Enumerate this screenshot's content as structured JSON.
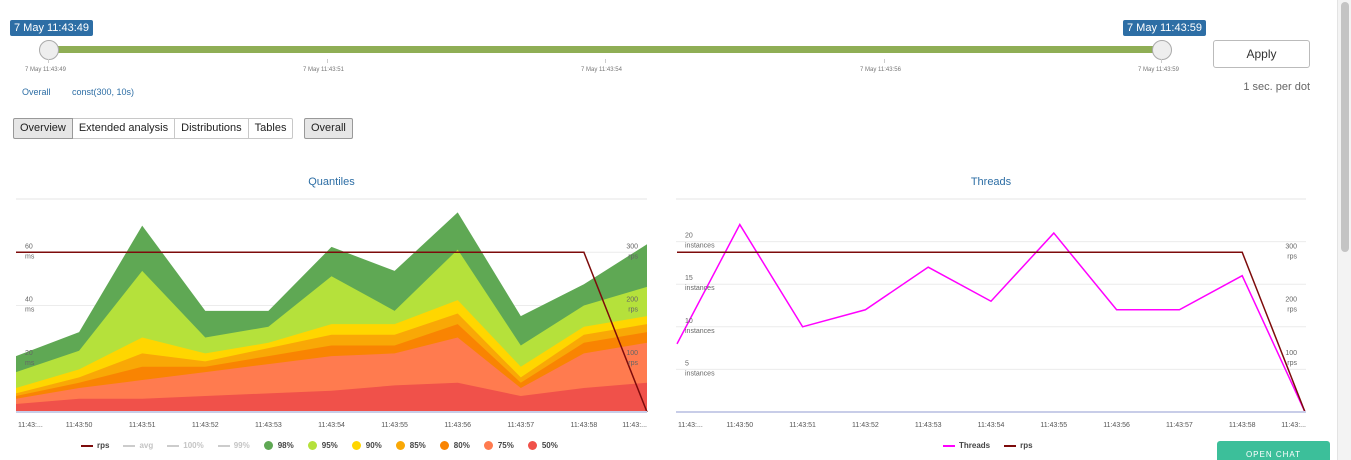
{
  "range": {
    "start_label": "7 May 11:43:49",
    "end_label": "7 May 11:43:59",
    "ticks": [
      "7 May 11:43:49",
      "7 May 11:43:51",
      "7 May 11:43:54",
      "7 May 11:43:56",
      "7 May 11:43:59"
    ],
    "track_color": "#8fae55"
  },
  "apply_label": "Apply",
  "per_dot_label": "1 sec. per dot",
  "links": {
    "overall": "Overall",
    "const": "const(300, 10s)"
  },
  "tabs": [
    {
      "label": "Overview",
      "active": true
    },
    {
      "label": "Extended analysis",
      "active": false
    },
    {
      "label": "Distributions",
      "active": false
    },
    {
      "label": "Tables",
      "active": false
    }
  ],
  "overall_button": "Overall",
  "chat_button": "OPEN CHAT",
  "chart_data": [
    {
      "type": "area",
      "title": "Quantiles",
      "x": [
        "11:43:...",
        "11:43:50",
        "11:43:51",
        "11:43:52",
        "11:43:53",
        "11:43:54",
        "11:43:55",
        "11:43:56",
        "11:43:57",
        "11:43:58",
        "11:43:..."
      ],
      "y_left": {
        "ticks": [
          20,
          40,
          60
        ],
        "unit": "ms",
        "ylim": [
          0,
          80
        ]
      },
      "y_right": {
        "ticks": [
          100,
          200,
          300
        ],
        "unit": "rps",
        "ylim": [
          0,
          400
        ]
      },
      "series": [
        {
          "name": "98%",
          "color": "#5fa854",
          "values": [
            21,
            30,
            70,
            38,
            38,
            62,
            53,
            75,
            36,
            48,
            63
          ]
        },
        {
          "name": "95%",
          "color": "#b5e13b",
          "values": [
            15,
            23,
            53,
            28,
            32,
            51,
            38,
            61,
            25,
            40,
            47
          ]
        },
        {
          "name": "90%",
          "color": "#ffd600",
          "values": [
            9,
            16,
            28,
            22,
            26,
            33,
            33,
            42,
            17,
            32,
            36
          ]
        },
        {
          "name": "85%",
          "color": "#f9a806",
          "values": [
            7,
            13,
            22,
            19,
            24,
            29,
            29,
            37,
            13,
            29,
            33
          ]
        },
        {
          "name": "80%",
          "color": "#f98402",
          "values": [
            6,
            11,
            17,
            17,
            21,
            25,
            25,
            33,
            11,
            26,
            30
          ]
        },
        {
          "name": "75%",
          "color": "#ff7b4f",
          "values": [
            5,
            9,
            12,
            15,
            18,
            21,
            22,
            28,
            9,
            22,
            26
          ]
        },
        {
          "name": "50%",
          "color": "#f0514a",
          "values": [
            3,
            5,
            5,
            6,
            7,
            8,
            10,
            11,
            6,
            9,
            11
          ]
        }
      ],
      "rps": {
        "name": "rps",
        "color": "#7d0b0b",
        "values": [
          300,
          300,
          300,
          300,
          300,
          300,
          300,
          300,
          300,
          300,
          0
        ]
      },
      "legend": [
        {
          "name": "rps",
          "kind": "line",
          "color": "#7d0b0b",
          "enabled": true
        },
        {
          "name": "avg",
          "kind": "line",
          "color": "#cccccc",
          "enabled": false
        },
        {
          "name": "100%",
          "kind": "line",
          "color": "#cccccc",
          "enabled": false
        },
        {
          "name": "99%",
          "kind": "line",
          "color": "#cccccc",
          "enabled": false
        },
        {
          "name": "98%",
          "kind": "dot",
          "color": "#5fa854",
          "enabled": true
        },
        {
          "name": "95%",
          "kind": "dot",
          "color": "#b5e13b",
          "enabled": true
        },
        {
          "name": "90%",
          "kind": "dot",
          "color": "#ffd600",
          "enabled": true
        },
        {
          "name": "85%",
          "kind": "dot",
          "color": "#f9a806",
          "enabled": true
        },
        {
          "name": "80%",
          "kind": "dot",
          "color": "#f98402",
          "enabled": true
        },
        {
          "name": "75%",
          "kind": "dot",
          "color": "#ff7b4f",
          "enabled": true
        },
        {
          "name": "50%",
          "kind": "dot",
          "color": "#f0514a",
          "enabled": true
        }
      ]
    },
    {
      "type": "line",
      "title": "Threads",
      "x": [
        "11:43:...",
        "11:43:50",
        "11:43:51",
        "11:43:52",
        "11:43:53",
        "11:43:54",
        "11:43:55",
        "11:43:56",
        "11:43:57",
        "11:43:58",
        "11:43:..."
      ],
      "y_left": {
        "ticks": [
          5,
          10,
          15,
          20
        ],
        "unit": "instances",
        "ylim": [
          0,
          25
        ]
      },
      "y_right": {
        "ticks": [
          100,
          200,
          300
        ],
        "unit": "rps",
        "ylim": [
          0,
          400
        ]
      },
      "series": [
        {
          "name": "Threads",
          "color": "#ff00ff",
          "values": [
            8,
            22,
            10,
            12,
            17,
            13,
            21,
            12,
            12,
            16,
            0
          ]
        },
        {
          "name": "rps",
          "color": "#7d0b0b",
          "values": [
            300,
            300,
            300,
            300,
            300,
            300,
            300,
            300,
            300,
            300,
            0
          ]
        }
      ],
      "legend": [
        {
          "name": "Threads",
          "kind": "line",
          "color": "#ff00ff",
          "enabled": true
        },
        {
          "name": "rps",
          "kind": "line",
          "color": "#7d0b0b",
          "enabled": true
        }
      ]
    }
  ]
}
